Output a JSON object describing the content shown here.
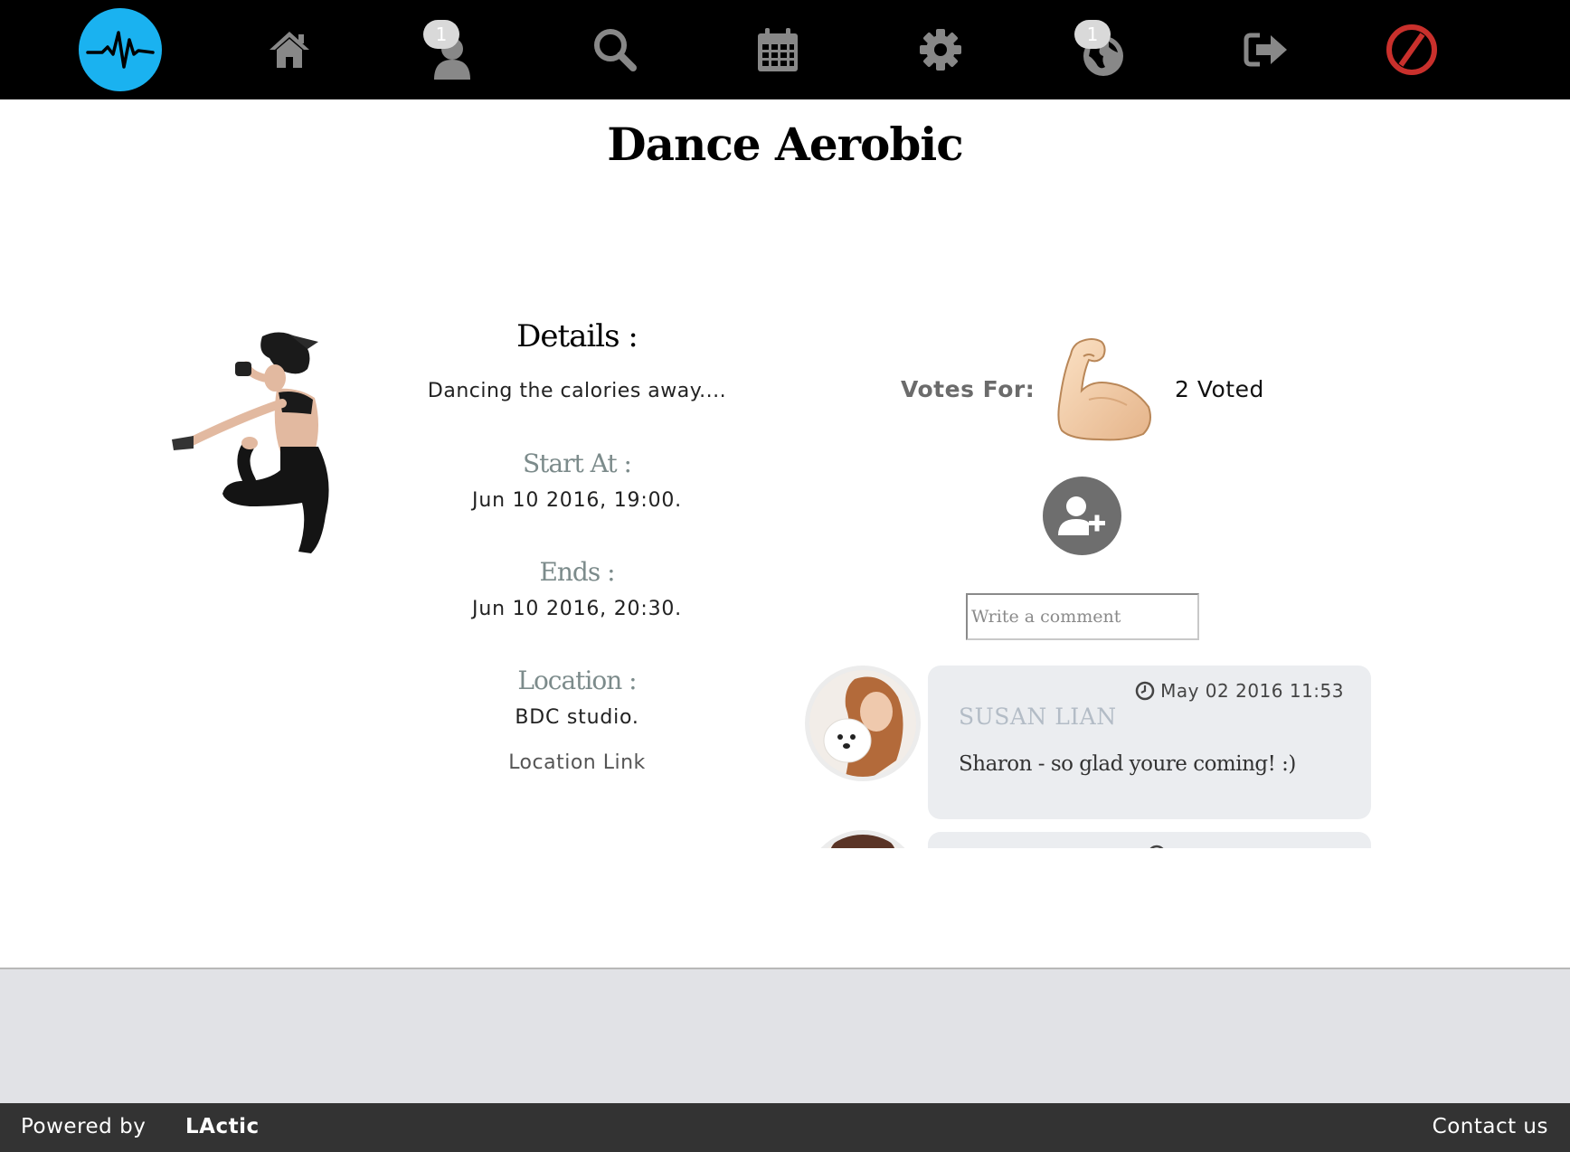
{
  "nav": {
    "items": [
      {
        "icon": "pulse-logo-icon"
      },
      {
        "icon": "home-icon"
      },
      {
        "icon": "user-icon",
        "badge": "1"
      },
      {
        "icon": "search-icon"
      },
      {
        "icon": "calendar-icon"
      },
      {
        "icon": "gear-icon"
      },
      {
        "icon": "globe-icon",
        "badge": "1"
      },
      {
        "icon": "sign-out-icon"
      },
      {
        "icon": "ban-icon"
      }
    ],
    "logo_color": "#1ab2f0",
    "ban_color": "#c9302c"
  },
  "event": {
    "title": "Dance Aerobic",
    "details_heading": "Details :",
    "description": "Dancing the calories away....",
    "start_label": "Start At :",
    "start_value": "Jun 10 2016, 19:00.",
    "end_label": "Ends :",
    "end_value": "Jun 10 2016, 20:30.",
    "location_label": "Location :",
    "location_value": "BDC studio.",
    "location_link": "Location Link"
  },
  "votes": {
    "label": "Votes For:",
    "count_text": "2 Voted",
    "icon": "flexed-biceps-icon"
  },
  "comment_box": {
    "placeholder": "Write a comment"
  },
  "comments": [
    {
      "time": "May 02 2016 11:53",
      "author": "SUSAN LIAN",
      "text": "Sharon - so glad youre coming! :)"
    }
  ],
  "footer": {
    "powered_by": "Powered by",
    "brand": "LActic",
    "contact": "Contact us"
  }
}
